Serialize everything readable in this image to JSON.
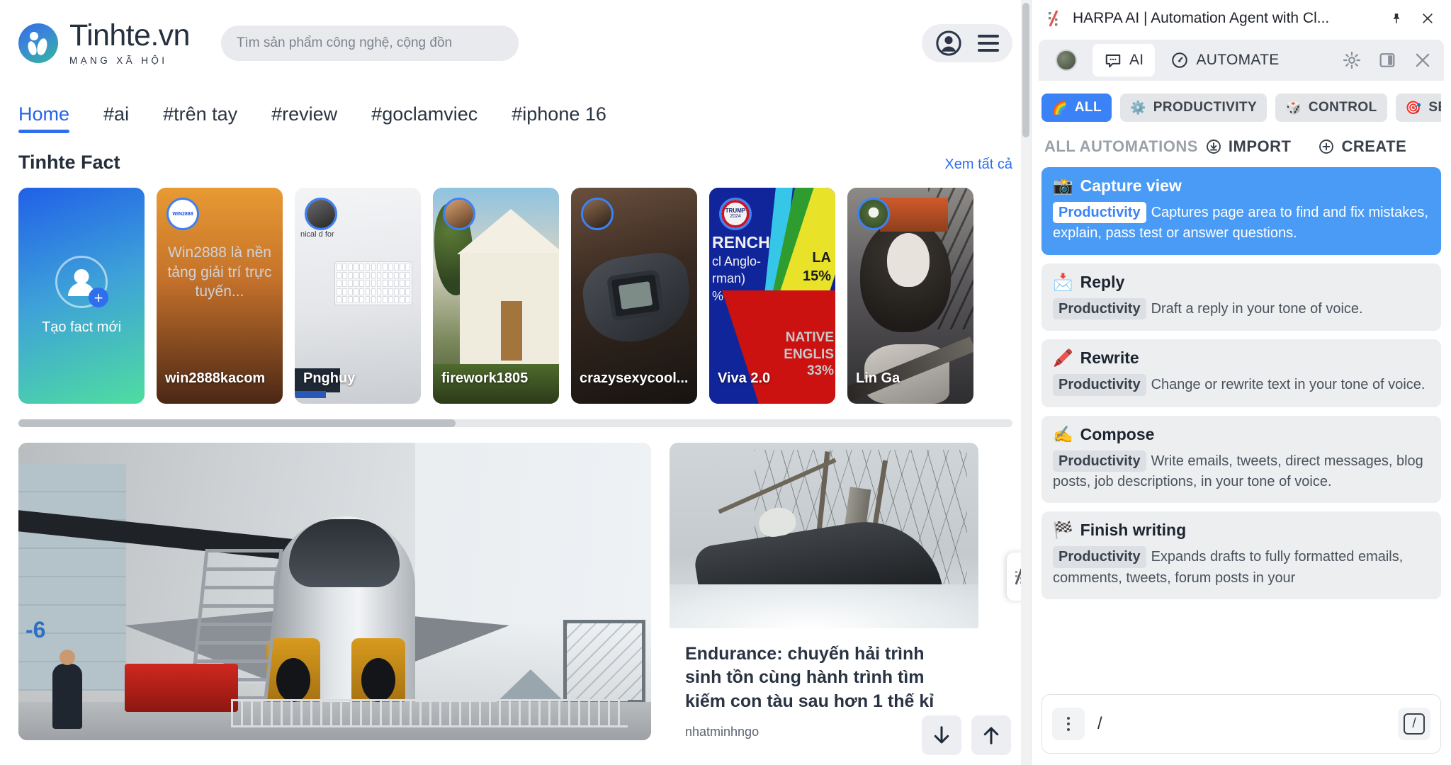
{
  "site": {
    "brand_name": "Tinhte.vn",
    "brand_sub": "MẠNG XÃ HỘI",
    "search_placeholder": "Tìm sản phẩm công nghệ, cộng đồn",
    "search_value": "",
    "nav": [
      {
        "label": "Home",
        "active": true
      },
      {
        "label": "#ai",
        "active": false
      },
      {
        "label": "#trên tay",
        "active": false
      },
      {
        "label": "#review",
        "active": false
      },
      {
        "label": "#goclamviec",
        "active": false
      },
      {
        "label": "#iphone 16",
        "active": false
      }
    ],
    "section": {
      "title": "Tinhte Fact",
      "see_all": "Xem tất cả"
    },
    "stories": [
      {
        "label": "Tạo fact mới",
        "kind": "create"
      },
      {
        "label": "win2888kacom",
        "kind": "win",
        "overlay_text": "Win2888 là nền tảng giải trí trực tuyến..."
      },
      {
        "label": "Pnghuy",
        "kind": "keyboard",
        "overlay_text": "nical\nd for"
      },
      {
        "label": "firework1805",
        "kind": "house"
      },
      {
        "label": "crazysexycool...",
        "kind": "watch"
      },
      {
        "label": "Viva 2.0",
        "kind": "pie",
        "chart_t1": "RENCH",
        "chart_t2": "cl Anglo-\nrman)\n%",
        "chart_t3": "LA\n15%",
        "chart_t4": "NATIVE\nENGLIS\n33%",
        "avatar_badge_top": "TRUMP",
        "avatar_badge_bottom": "2024"
      },
      {
        "label": "Lin Ga",
        "kind": "guitar"
      }
    ],
    "articles": [
      {
        "kind": "jet",
        "overlay_number": "-6"
      },
      {
        "kind": "ship",
        "title": "Endurance: chuyến hải trình sinh tồn cùng hành trình tìm kiếm con tàu sau hơn 1 thế kỉ",
        "author": "nhatminhngo"
      }
    ]
  },
  "harpa": {
    "window_title": "HARPA AI | Automation Agent with Cl...",
    "tabs": [
      {
        "label": "",
        "icon": "globe-avatar",
        "active": false
      },
      {
        "label": "AI",
        "icon": "chat-icon",
        "active": true
      },
      {
        "label": "AUTOMATE",
        "icon": "gauge-icon",
        "active": false
      }
    ],
    "chips": [
      {
        "label": "ALL",
        "emoji": "🌈",
        "active": true
      },
      {
        "label": "PRODUCTIVITY",
        "emoji": "⚙️",
        "active": false
      },
      {
        "label": "CONTROL",
        "emoji": "🎲",
        "active": false
      },
      {
        "label": "SE",
        "emoji": "🎯",
        "active": false
      }
    ],
    "list_header": {
      "label": "ALL AUTOMATIONS",
      "import": "IMPORT",
      "create": "CREATE"
    },
    "automations": [
      {
        "emoji": "📸",
        "name": "Capture view",
        "badge": "Productivity",
        "desc": "Captures page area to find and fix mistakes, explain, pass test or answer questions.",
        "selected": true
      },
      {
        "emoji": "📩",
        "name": "Reply",
        "badge": "Productivity",
        "desc": "Draft a reply in your tone of voice.",
        "selected": false
      },
      {
        "emoji": "🖍️",
        "name": "Rewrite",
        "badge": "Productivity",
        "desc": "Change or rewrite text in your tone of voice.",
        "selected": false
      },
      {
        "emoji": "✍️",
        "name": "Compose",
        "badge": "Productivity",
        "desc": "Write emails, tweets, direct messages, blog posts, job descriptions, in your tone of voice.",
        "selected": false
      },
      {
        "emoji": "🏁",
        "name": "Finish writing",
        "badge": "Productivity",
        "desc": "Expands drafts to fully formatted emails, comments, tweets, forum posts in your",
        "selected": false
      }
    ],
    "input": {
      "value": "/",
      "slash_key": "/"
    }
  },
  "colors": {
    "accent_blue": "#2f6fed",
    "harpa_blue": "#4a9bf5",
    "chip_active": "#3b82f6"
  }
}
